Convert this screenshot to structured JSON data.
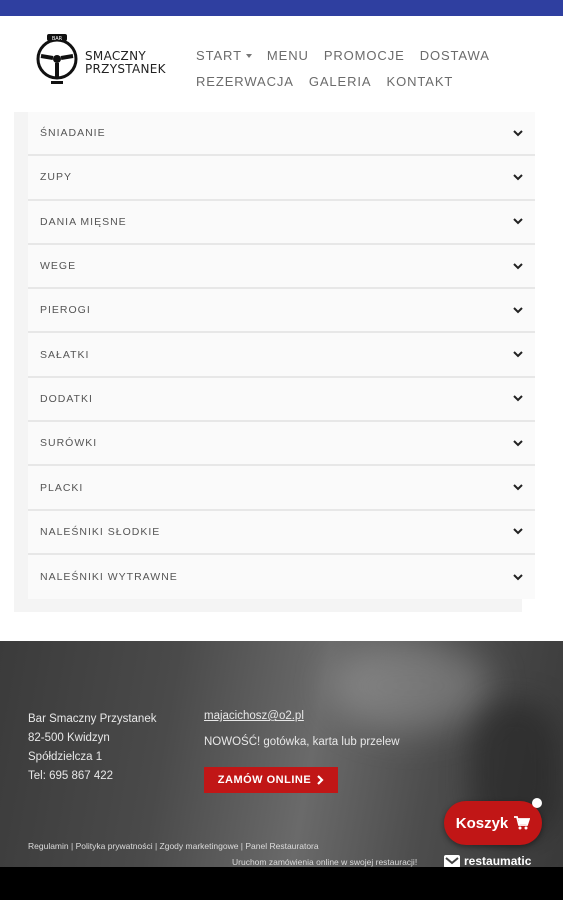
{
  "brand": {
    "name_line1": "SMACZNY",
    "name_line2": "PRZYSTANEK",
    "logo_text": "BAR"
  },
  "nav": {
    "row1": [
      "START",
      "MENU",
      "PROMOCJE",
      "DOSTAWA"
    ],
    "row2": [
      "REZERWACJA",
      "GALERIA",
      "KONTAKT"
    ]
  },
  "categories": [
    "ŚNIADANIE",
    "ZUPY",
    "DANIA MIĘSNE",
    "WEGE",
    "PIEROGI",
    "SAŁATKI",
    "DODATKI",
    "SURÓWKI",
    "PLACKI",
    "NALEŚNIKI SŁODKIE",
    "NALEŚNIKI WYTRAWNE"
  ],
  "footer": {
    "address": [
      "Bar Smaczny Przystanek",
      "82-500 Kwidzyn",
      "Spółdzielcza 1",
      "Tel: 695 867 422"
    ],
    "email": "majacichosz@o2.pl",
    "payment": "NOWOŚĆ! gotówka, karta lub przelew",
    "order_button": "ZAMÓW ONLINE",
    "links": [
      "Regulamin",
      "Polityka prywatności",
      "Zgody marketingowe",
      "Panel Restauratora"
    ],
    "restaumatic_text": "Uruchom zamówienia online w swojej restauracji!",
    "restaumatic_brand": "restaumatic"
  },
  "cart": {
    "label": "Koszyk"
  },
  "colors": {
    "topbar": "#2f3fa0",
    "accent": "#c11616"
  }
}
